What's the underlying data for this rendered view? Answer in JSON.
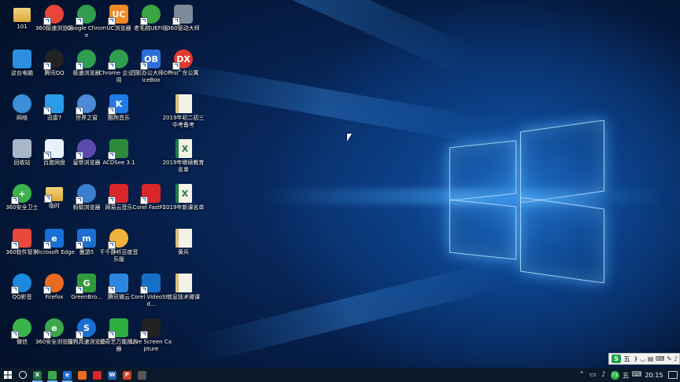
{
  "desktop": {
    "icons": [
      {
        "label": "101",
        "glyph": "",
        "color": "#d9a93a",
        "shape": "folder"
      },
      {
        "label": "360极速浏览器",
        "glyph": "",
        "color": "#e9453b",
        "shape": "round"
      },
      {
        "label": "Google Chrome",
        "glyph": "",
        "color": "#2f9e4f",
        "shape": "round"
      },
      {
        "label": "UC浏览器",
        "glyph": "UC",
        "color": "#f08a24",
        "shape": "square"
      },
      {
        "label": "老毛桃UEFI版",
        "glyph": "",
        "color": "#3aa640",
        "shape": "round"
      },
      {
        "label": "360驱动大师",
        "glyph": "",
        "color": "#7d8a99",
        "shape": "square"
      },
      {
        "label": "这台电脑",
        "glyph": "",
        "color": "#2c8ee0",
        "shape": "square"
      },
      {
        "label": "腾讯QQ",
        "glyph": "",
        "color": "#222222",
        "shape": "round"
      },
      {
        "label": "极速浏览器",
        "glyph": "",
        "color": "#2f9e4f",
        "shape": "round"
      },
      {
        "label": "Chrome 企业应用",
        "glyph": "",
        "color": "#2f9e4f",
        "shape": "round"
      },
      {
        "label": "万彩办公大师OfficeBox",
        "glyph": "OB",
        "color": "#2e6fd8",
        "shape": "square"
      },
      {
        "label": "Pro广东公寓",
        "glyph": "DX",
        "color": "#e23b2e",
        "shape": "round"
      },
      {
        "label": "网络",
        "glyph": "",
        "color": "#3b8fd9",
        "shape": "round"
      },
      {
        "label": "迅雷7",
        "glyph": "",
        "color": "#2a9be8",
        "shape": "square"
      },
      {
        "label": "世界之窗",
        "glyph": "",
        "color": "#4a8ad8",
        "shape": "round"
      },
      {
        "label": "酷狗音乐",
        "glyph": "K",
        "color": "#1e7be8",
        "shape": "square"
      },
      {
        "label": "2019年初二初三中考备考",
        "glyph": "",
        "color": "#d9c27a",
        "shape": "doc"
      },
      {
        "label": "回收站",
        "glyph": "",
        "color": "#a8b8c8",
        "shape": "square"
      },
      {
        "label": "百度网盘",
        "glyph": "",
        "color": "#e8f0fa",
        "shape": "square"
      },
      {
        "label": "皇帝浏览器",
        "glyph": "",
        "color": "#5a4bb0",
        "shape": "round"
      },
      {
        "label": "ACDSee 3.1",
        "glyph": "",
        "color": "#2b8a3a",
        "shape": "square"
      },
      {
        "label": "2019年继续教育名单",
        "glyph": "X",
        "color": "#1f7a45",
        "shape": "doc"
      },
      {
        "label": "360安全卫士",
        "glyph": "+",
        "color": "#3ab34a",
        "shape": "round"
      },
      {
        "label": "临时",
        "glyph": "",
        "color": "#d9a93a",
        "shape": "folder"
      },
      {
        "label": "蚂蚁浏览器",
        "glyph": "",
        "color": "#3a7fd0",
        "shape": "round"
      },
      {
        "label": "网易云音乐",
        "glyph": "",
        "color": "#d8262a",
        "shape": "square"
      },
      {
        "label": "Corel FastFl...",
        "glyph": "",
        "color": "#d8262a",
        "shape": "square"
      },
      {
        "label": "2019年新课名单",
        "glyph": "X",
        "color": "#1f7a45",
        "shape": "doc"
      },
      {
        "label": "360软件管家",
        "glyph": "",
        "color": "#e8493b",
        "shape": "square"
      },
      {
        "label": "Microsoft Edge",
        "glyph": "e",
        "color": "#1a6fd6",
        "shape": "square"
      },
      {
        "label": "傲游5",
        "glyph": "m",
        "color": "#1f6fd0",
        "shape": "square"
      },
      {
        "label": "千千静听百度音乐版",
        "glyph": "",
        "color": "#f0b23a",
        "shape": "round"
      },
      {
        "label": "黄兵",
        "glyph": "",
        "color": "#d9c27a",
        "shape": "doc"
      },
      {
        "label": "QQ影音",
        "glyph": "",
        "color": "#1a8ae0",
        "shape": "round"
      },
      {
        "label": "Firefox",
        "glyph": "",
        "color": "#ea6b1f",
        "shape": "round"
      },
      {
        "label": "GreenBro...",
        "glyph": "G",
        "color": "#2f9a3a",
        "shape": "square"
      },
      {
        "label": "腾讯微云",
        "glyph": "",
        "color": "#2c86e0",
        "shape": "square"
      },
      {
        "label": "Corel VideoStud...",
        "glyph": "",
        "color": "#1670c8",
        "shape": "square"
      },
      {
        "label": "信息技术微课",
        "glyph": "",
        "color": "#d9c27a",
        "shape": "doc"
      },
      {
        "label": "微信",
        "glyph": "",
        "color": "#39b54a",
        "shape": "round"
      },
      {
        "label": "360安全浏览器",
        "glyph": "e",
        "color": "#3aa84a",
        "shape": "round"
      },
      {
        "label": "搜狗高速浏览器",
        "glyph": "S",
        "color": "#1a6fd6",
        "shape": "round"
      },
      {
        "label": "爱奇艺万能播放器",
        "glyph": "",
        "color": "#2cae3e",
        "shape": "square"
      },
      {
        "label": "Live Screen Capture",
        "glyph": "",
        "color": "#222222",
        "shape": "square"
      }
    ]
  },
  "ime_bar": {
    "logo": "S",
    "mode": "五",
    "symbols": "❩ ◡ ▤ ⌨ ✎ ♪"
  },
  "taskbar": {
    "apps": [
      {
        "name": "excel",
        "glyph": "X",
        "color": "#1f7a45"
      },
      {
        "name": "360browser",
        "glyph": "",
        "color": "#3aa84a"
      },
      {
        "name": "edge",
        "glyph": "e",
        "color": "#1a6fd6"
      },
      {
        "name": "firefox",
        "glyph": "",
        "color": "#ea6b1f"
      },
      {
        "name": "netease",
        "glyph": "",
        "color": "#d8262a"
      },
      {
        "name": "word",
        "glyph": "W",
        "color": "#2b5fb0"
      },
      {
        "name": "powerpoint",
        "glyph": "P",
        "color": "#d04423"
      },
      {
        "name": "screen-capture",
        "glyph": "",
        "color": "#555555"
      }
    ],
    "tray": {
      "badge": "73",
      "ime": "五",
      "time": "20:15"
    }
  },
  "colors": {
    "taskbar": "#0b1a2a",
    "accent": "#76b9ed",
    "ime_green": "#1fa04a"
  }
}
